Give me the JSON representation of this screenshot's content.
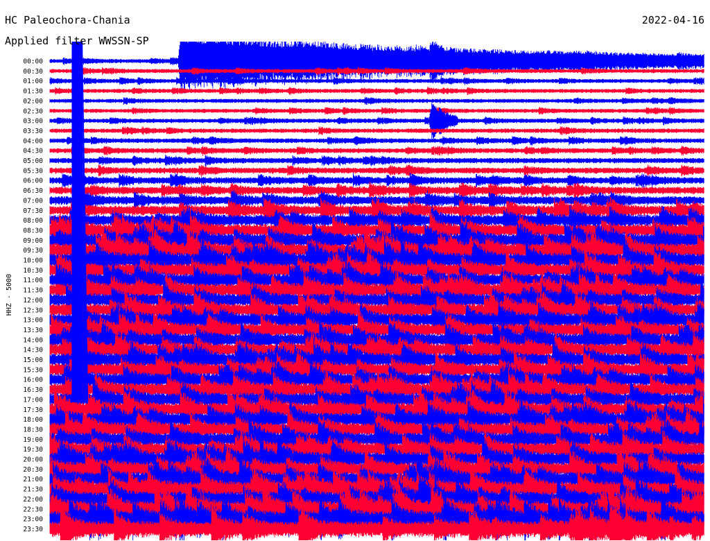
{
  "header": {
    "station": "HC Paleochora-Chania",
    "date": "2022-04-16",
    "filter": "Applied filter WWSSN-SP"
  },
  "colors": {
    "blue": "#0000ff",
    "red": "#ff0033"
  },
  "chart_data": {
    "type": "line",
    "title": "HC Paleochora-Chania",
    "subtitle": "Applied filter WWSSN-SP",
    "date": "2022-04-16",
    "ylabel": "HHZ - 5000",
    "xlabel": "",
    "y_ticks": [
      "00:00",
      "00:30",
      "01:00",
      "01:30",
      "02:00",
      "02:30",
      "03:00",
      "03:30",
      "04:00",
      "04:30",
      "05:00",
      "05:30",
      "06:00",
      "06:30",
      "07:00",
      "07:30",
      "08:00",
      "08:30",
      "09:00",
      "09:30",
      "10:00",
      "10:30",
      "11:00",
      "11:30",
      "12:00",
      "12:30",
      "13:00",
      "13:30",
      "14:00",
      "14:30",
      "15:00",
      "15:30",
      "16:00",
      "16:30",
      "17:00",
      "17:30",
      "18:00",
      "18:30",
      "19:00",
      "19:30",
      "20:00",
      "20:30",
      "21:00",
      "21:30",
      "22:00",
      "22:30",
      "23:00",
      "23:30"
    ],
    "series_colors": [
      "#0000ff",
      "#ff0033"
    ],
    "noise_level": [
      0.1,
      0.1,
      0.1,
      0.1,
      0.1,
      0.1,
      0.12,
      0.13,
      0.15,
      0.17,
      0.2,
      0.25,
      0.3,
      0.35,
      0.45,
      0.55,
      0.65,
      0.75,
      0.85,
      0.9,
      0.9,
      0.85,
      0.8,
      0.8,
      0.8,
      0.8,
      0.8,
      0.8,
      0.8,
      0.8,
      0.8,
      0.8,
      0.8,
      0.8,
      0.85,
      0.85,
      0.85,
      0.85,
      0.85,
      0.85,
      0.9,
      0.9,
      0.9,
      0.95,
      0.95,
      1.0,
      1.0,
      1.0
    ],
    "events": [
      {
        "trace": "00:00",
        "minute": 6,
        "amplitude": 40,
        "duration_min": 24
      },
      {
        "trace": "00:00",
        "minute": 17.5,
        "amplitude": 8,
        "duration_min": 0.6
      },
      {
        "trace": "03:00",
        "minute": 17.5,
        "amplitude": 25,
        "duration_min": 1.2
      },
      {
        "trace": "00:00",
        "minute": 17.5,
        "amplitude": 5,
        "duration_min": 0.5
      },
      {
        "trace": "04:00",
        "minute": 14,
        "amplitude": 4,
        "duration_min": 1
      }
    ]
  }
}
